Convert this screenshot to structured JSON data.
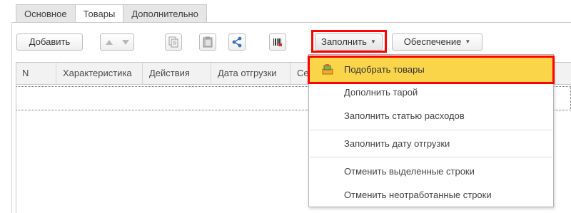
{
  "tabs": [
    {
      "label": "Основное",
      "active": false
    },
    {
      "label": "Товары",
      "active": true
    },
    {
      "label": "Дополнительно",
      "active": false
    }
  ],
  "toolbar": {
    "add_label": "Добавить",
    "fill_label": "Заполнить",
    "provision_label": "Обеспечение"
  },
  "table": {
    "columns": [
      "N",
      "Характеристика",
      "Действия",
      "Дата отгрузки",
      "Се"
    ]
  },
  "menu": {
    "items": [
      {
        "label": "Подобрать товары",
        "highlighted": true
      },
      {
        "label": "Дополнить тарой"
      },
      {
        "label": "Заполнить статью расходов"
      },
      {
        "label": "Заполнить дату отгрузки"
      },
      {
        "label": "Отменить выделенные строки"
      },
      {
        "label": "Отменить неотработанные строки"
      }
    ]
  },
  "colors": {
    "highlight_border": "#ff0000",
    "menu_active": "#fad54a"
  }
}
